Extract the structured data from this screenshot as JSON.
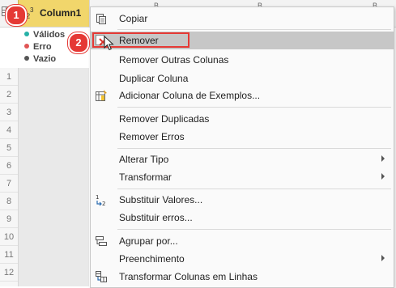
{
  "grid": {
    "column1": {
      "type_icon": "1²₃",
      "type_main": "1",
      "type_sub": "2",
      "type_sup": "3",
      "name": "Column1"
    },
    "column2_labels": [
      "B",
      "B",
      "B"
    ],
    "quality": [
      {
        "label": "Válidos",
        "color": "#26b1a7"
      },
      {
        "label": "Erro",
        "color": "#e05555"
      },
      {
        "label": "Vazio",
        "color": "#555555"
      }
    ],
    "row_numbers": [
      "1",
      "2",
      "3",
      "4",
      "5",
      "6",
      "7",
      "8",
      "9",
      "10",
      "11",
      "12"
    ]
  },
  "badges": {
    "step1": "1",
    "step2": "2"
  },
  "menu": {
    "items": [
      {
        "label": "Copiar",
        "icon": "copy-icon"
      },
      {
        "label": "Remover",
        "icon": "remove-x-icon",
        "state": "hovered-highlighted"
      },
      {
        "label": "Remover Outras Colunas"
      },
      {
        "label": "Duplicar Coluna"
      },
      {
        "label": "Adicionar Coluna de Exemplos...",
        "icon": "add-column-examples-icon"
      },
      {
        "label": "Remover Duplicadas"
      },
      {
        "label": "Remover Erros"
      },
      {
        "label": "Alterar Tipo",
        "submenu": true
      },
      {
        "label": "Transformar",
        "submenu": true
      },
      {
        "label": "Substituir Valores...",
        "icon": "replace-values-icon",
        "icon_text": "1",
        "icon_text2": "2"
      },
      {
        "label": "Substituir erros..."
      },
      {
        "label": "Agrupar por...",
        "icon": "group-by-icon"
      },
      {
        "label": "Preenchimento",
        "submenu": true
      },
      {
        "label": "Transformar Colunas em Linhas",
        "icon": "unpivot-icon"
      }
    ]
  },
  "colors": {
    "accent_red": "#e53935",
    "header_yellow": "#f1d66b",
    "hover_gray": "#c7c7c7"
  }
}
